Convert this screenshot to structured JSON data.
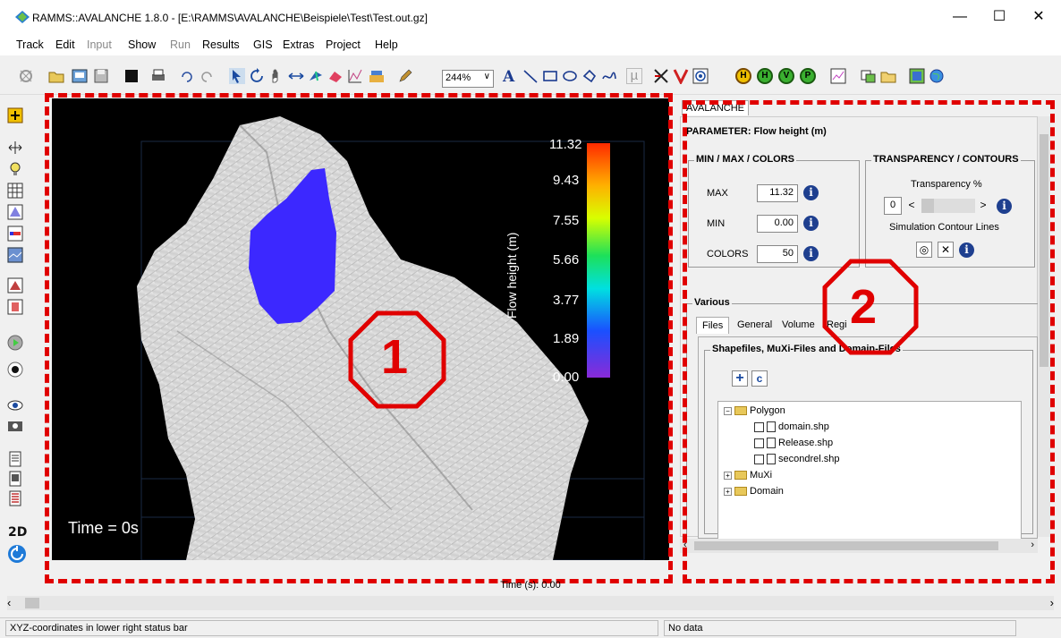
{
  "window": {
    "title": "RAMMS::AVALANCHE 1.8.0  - [E:\\RAMMS\\AVALANCHE\\Beispiele\\Test\\Test.out.gz]",
    "minimize": "—",
    "maximize": "☐",
    "close": "✕"
  },
  "menu": [
    {
      "label": "Track",
      "enabled": true
    },
    {
      "label": "Edit",
      "enabled": true
    },
    {
      "label": "Input",
      "enabled": false
    },
    {
      "label": "Show",
      "enabled": true
    },
    {
      "label": "Run",
      "enabled": false
    },
    {
      "label": "Results",
      "enabled": true
    },
    {
      "label": "GIS",
      "enabled": true
    },
    {
      "label": "Extras",
      "enabled": true
    },
    {
      "label": "Project",
      "enabled": true
    },
    {
      "label": "Help",
      "enabled": true
    }
  ],
  "toolbar": {
    "zoom_value": "244%",
    "text_tool": "A",
    "lambda_tool": "µ",
    "h_buttons": [
      "H",
      "H",
      "V",
      "P"
    ]
  },
  "viewport": {
    "time_label": "Time = 0s",
    "legend_title": "Flow height (m)",
    "legend_ticks": [
      "11.32",
      "9.43",
      "7.55",
      "5.66",
      "3.77",
      "1.89",
      "0.00"
    ],
    "annotation_1": "1"
  },
  "panel": {
    "tab": "AVALANCHE",
    "parameter": "PARAMETER: Flow height (m)",
    "minmax": {
      "title": "MIN / MAX / COLORS",
      "max_label": "MAX",
      "max_value": "11.32",
      "min_label": "MIN",
      "min_value": "0.00",
      "colors_label": "COLORS",
      "colors_value": "50"
    },
    "transparency": {
      "title": "TRANSPARENCY / CONTOURS",
      "label": "Transparency %",
      "value": "0",
      "contour_label": "Simulation Contour Lines"
    },
    "various": {
      "title": "Various",
      "tabs": [
        "Files",
        "General",
        "Volume",
        "Regi"
      ],
      "files_group": "Shapefiles, MuXi-Files and Domain-Files",
      "tree": {
        "polygon": "Polygon",
        "files": [
          "domain.shp",
          "Release.shp",
          "secondrel.shp"
        ],
        "muxi": "MuXi",
        "domain": "Domain"
      }
    },
    "annotation_2": "2"
  },
  "time_readout": "Time (s): 0.00",
  "status": {
    "left": "XYZ-coordinates in lower right status bar",
    "right": "No data"
  },
  "colors": {
    "annotation_red": "#e00000",
    "info_blue": "#1e3f8f",
    "release_blue": "#3c28ff"
  }
}
